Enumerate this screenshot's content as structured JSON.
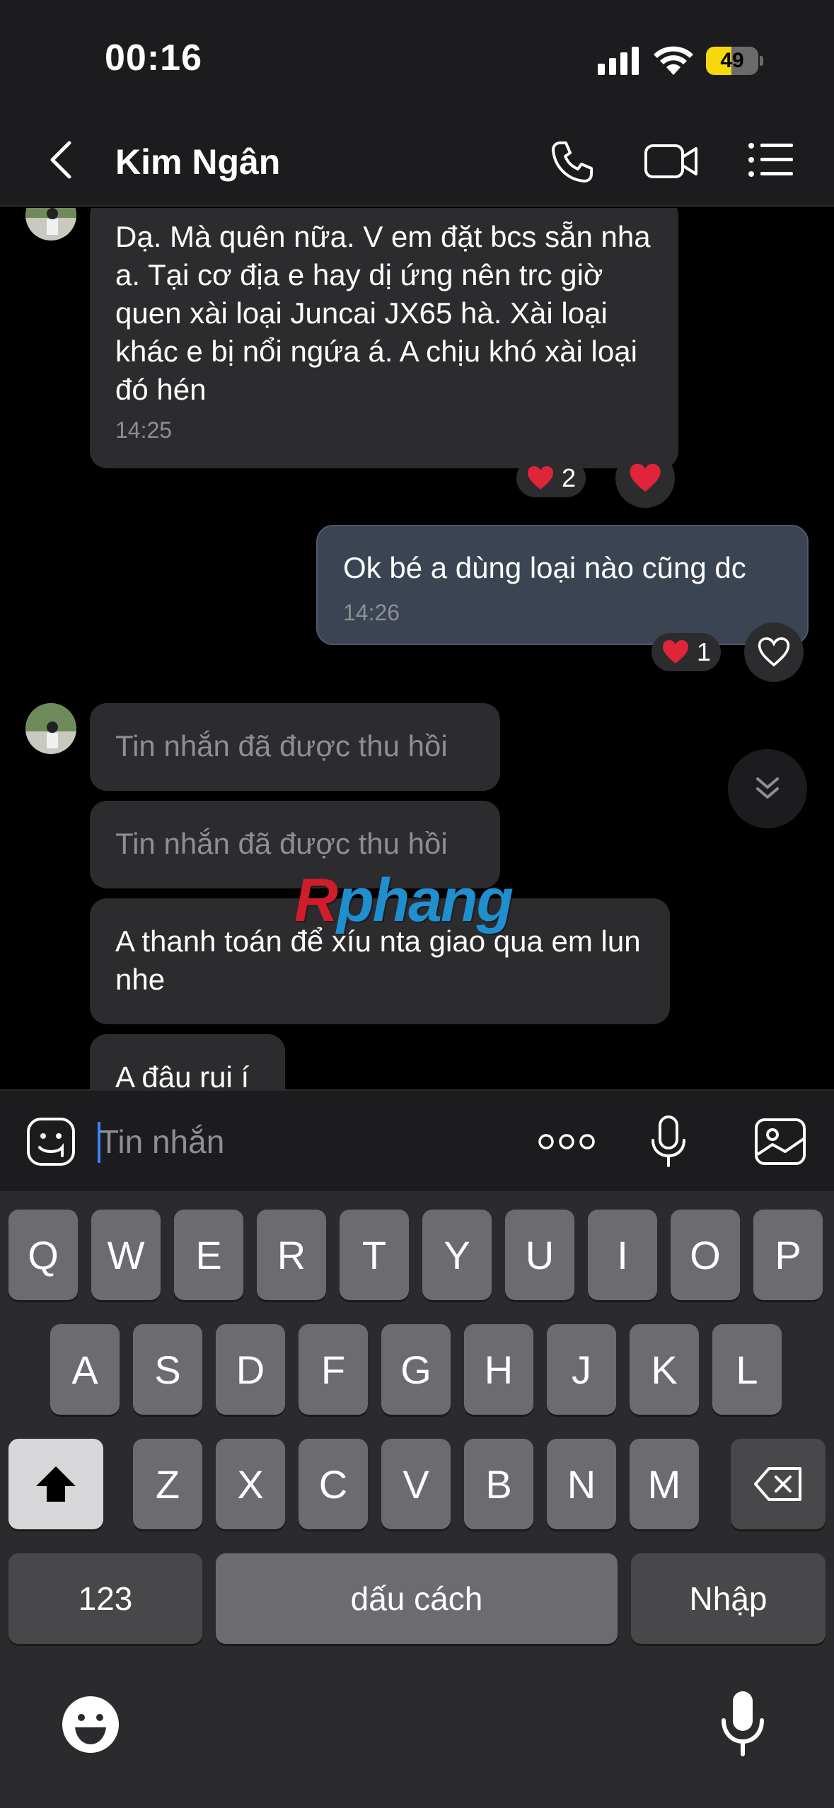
{
  "status": {
    "time": "00:16",
    "battery": "49",
    "battery_level": 0.49
  },
  "header": {
    "contact_name": "Kim Ngân"
  },
  "messages": [
    {
      "text": "Dạ. Mà quên nữa. V em đặt bcs sẵn nha a. Tại cơ địa e hay dị ứng nên trc giờ quen xài loại Juncai JX65 hà. Xài loại khác e bị nổi ngứa á. A chịu khó xài loại đó hén",
      "time": "14:25",
      "reaction_count": "2"
    },
    {
      "text": "Ok bé a dùng loại nào cũng dc",
      "time": "14:26",
      "reaction_count": "1"
    },
    {
      "text": "Tin nhắn đã được thu hồi"
    },
    {
      "text": "Tin nhắn đã được thu hồi"
    },
    {
      "text": "A thanh toán để xíu nta giao qua em lun nhe"
    },
    {
      "text": "A đâu rui í"
    }
  ],
  "watermark": {
    "part1": "R",
    "part2": "phang"
  },
  "input": {
    "placeholder": "Tin nhắn"
  },
  "keyboard": {
    "row1": [
      "Q",
      "W",
      "E",
      "R",
      "T",
      "Y",
      "U",
      "I",
      "O",
      "P"
    ],
    "row2": [
      "A",
      "S",
      "D",
      "F",
      "G",
      "H",
      "J",
      "K",
      "L"
    ],
    "row3": [
      "Z",
      "X",
      "C",
      "V",
      "B",
      "N",
      "M"
    ],
    "numbers": "123",
    "space": "dấu cách",
    "return": "Nhập"
  },
  "colors": {
    "accent": "#3b82f6",
    "heart": "#e0243a",
    "outgoing_bubble": "#3a4452",
    "incoming_bubble": "#2c2c2e"
  }
}
